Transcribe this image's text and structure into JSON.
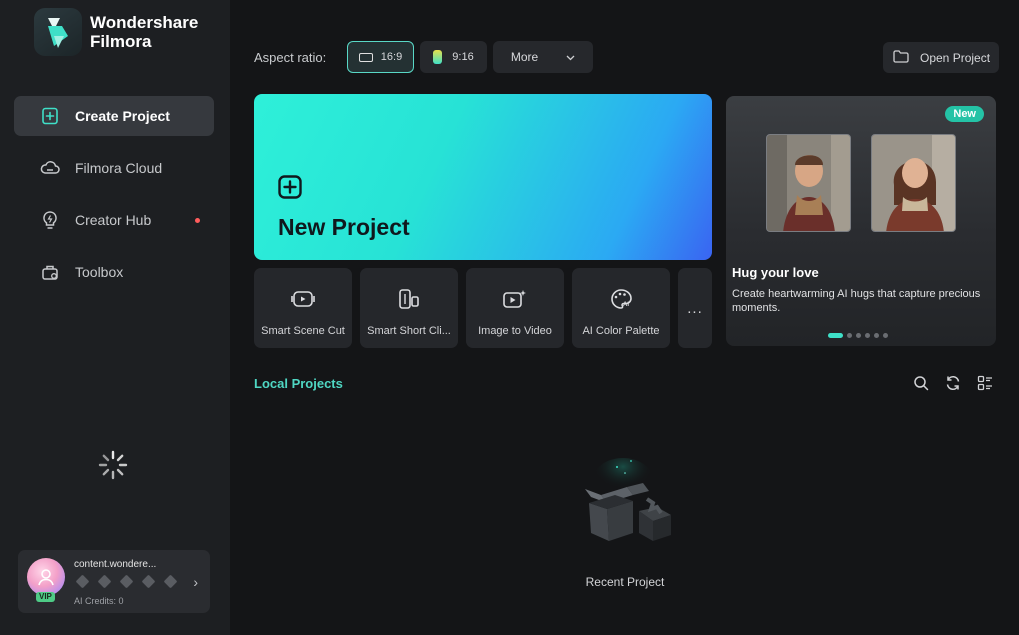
{
  "app": {
    "name_line1": "Wondershare",
    "name_line2": "Filmora"
  },
  "sidebar": {
    "items": [
      {
        "label": "Create Project",
        "icon": "create-project-icon",
        "active": true
      },
      {
        "label": "Filmora Cloud",
        "icon": "cloud-icon"
      },
      {
        "label": "Creator Hub",
        "icon": "bulb-icon",
        "has_dot": true
      },
      {
        "label": "Toolbox",
        "icon": "toolbox-icon"
      }
    ],
    "user": {
      "name": "content.wondere...",
      "badge": "VIP",
      "credits": "AI Credits: 0"
    }
  },
  "topbar": {
    "aspect_label": "Aspect ratio:",
    "ratios": [
      {
        "label": "16:9",
        "selected": true
      },
      {
        "label": "9:16",
        "selected": false
      }
    ],
    "more_label": "More",
    "open_project_label": "Open Project"
  },
  "new_project": {
    "title": "New Project"
  },
  "tools": [
    {
      "label": "Smart Scene Cut",
      "icon": "scene-cut-icon"
    },
    {
      "label": "Smart Short Cli...",
      "icon": "short-clip-icon"
    },
    {
      "label": "Image to Video",
      "icon": "image-to-video-icon"
    },
    {
      "label": "AI Color Palette",
      "icon": "palette-icon"
    }
  ],
  "tools_more": "...",
  "promo": {
    "badge": "New",
    "title": "Hug your love",
    "description": "Create heartwarming AI hugs that capture precious moments.",
    "slides_total": 6,
    "slide_active": 1
  },
  "local_projects": {
    "title": "Local Projects",
    "empty_label": "Recent Project"
  },
  "colors": {
    "accent": "#4fd7c3",
    "new_project_gradient_start": "#2ef0d9",
    "new_project_gradient_end": "#3a64f2",
    "sidebar_bg": "#1d1f22",
    "main_bg": "#141517"
  }
}
